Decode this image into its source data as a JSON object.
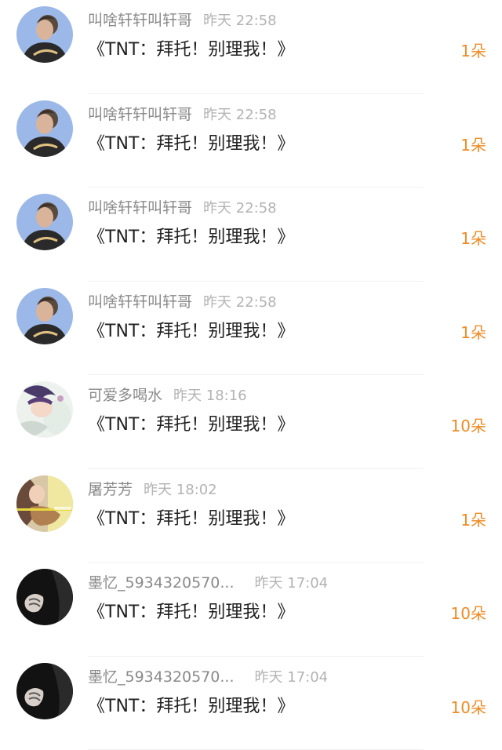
{
  "rows": [
    {
      "name": "叫啥轩轩叫轩哥",
      "time": "昨天 22:58",
      "title": "《TNT：拜托！别理我！》",
      "count": "1朵",
      "avatar": "boy-avatar"
    },
    {
      "name": "叫啥轩轩叫轩哥",
      "time": "昨天 22:58",
      "title": "《TNT：拜托！别理我！》",
      "count": "1朵",
      "avatar": "boy-avatar"
    },
    {
      "name": "叫啥轩轩叫轩哥",
      "time": "昨天 22:58",
      "title": "《TNT：拜托！别理我！》",
      "count": "1朵",
      "avatar": "boy-avatar"
    },
    {
      "name": "叫啥轩轩叫轩哥",
      "time": "昨天 22:58",
      "title": "《TNT：拜托！别理我！》",
      "count": "1朵",
      "avatar": "boy-avatar"
    },
    {
      "name": "可爱多喝水",
      "time": "昨天 18:16",
      "title": "《TNT：拜托！别理我！》",
      "count": "10朵",
      "avatar": "anime-avatar"
    },
    {
      "name": "屠芳芳",
      "time": "昨天 18:02",
      "title": "《TNT：拜托！别理我！》",
      "count": "1朵",
      "avatar": "guitar-girl-avatar"
    },
    {
      "name": "墨忆_5934320570...",
      "time": "昨天 17:04",
      "title": "《TNT：拜托！别理我！》",
      "count": "10朵",
      "avatar": "dark-hands-avatar"
    },
    {
      "name": "墨忆_5934320570...",
      "time": "昨天 17:04",
      "title": "《TNT：拜托！别理我！》",
      "count": "10朵",
      "avatar": "dark-hands-avatar"
    }
  ],
  "colors": {
    "count": "#f08a24",
    "name": "#8a8a8a",
    "time": "#b3b3b3",
    "title": "#222222"
  }
}
